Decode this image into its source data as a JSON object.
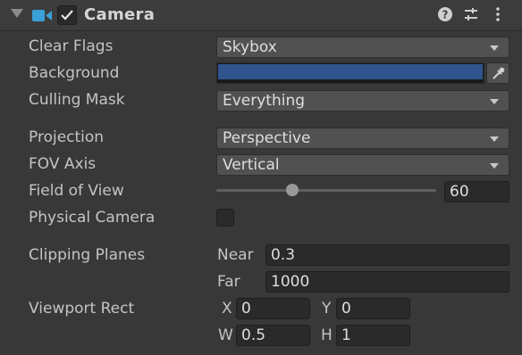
{
  "header": {
    "title": "Camera",
    "enabled": true,
    "icons": [
      "camera-icon",
      "help-icon",
      "presets-icon",
      "more-menu-icon"
    ]
  },
  "properties": {
    "clear_flags": {
      "label": "Clear Flags",
      "value": "Skybox"
    },
    "background": {
      "label": "Background",
      "color": "#30548e"
    },
    "culling_mask": {
      "label": "Culling Mask",
      "value": "Everything"
    },
    "projection": {
      "label": "Projection",
      "value": "Perspective"
    },
    "fov_axis": {
      "label": "FOV Axis",
      "value": "Vertical"
    },
    "field_of_view": {
      "label": "Field of View",
      "value": "60"
    },
    "physical_camera": {
      "label": "Physical Camera",
      "checked": false
    },
    "clipping_planes": {
      "label": "Clipping Planes",
      "near_label": "Near",
      "near": "0.3",
      "far_label": "Far",
      "far": "1000"
    },
    "viewport_rect": {
      "label": "Viewport Rect",
      "x_label": "X",
      "x": "0",
      "y_label": "Y",
      "y": "0",
      "w_label": "W",
      "w": "0.5",
      "h_label": "H",
      "h": "1"
    }
  },
  "colors": {
    "panel": "#383838",
    "field": "#2a2a2a",
    "dropdown": "#515151",
    "accent_camera": "#3aa0d8"
  }
}
